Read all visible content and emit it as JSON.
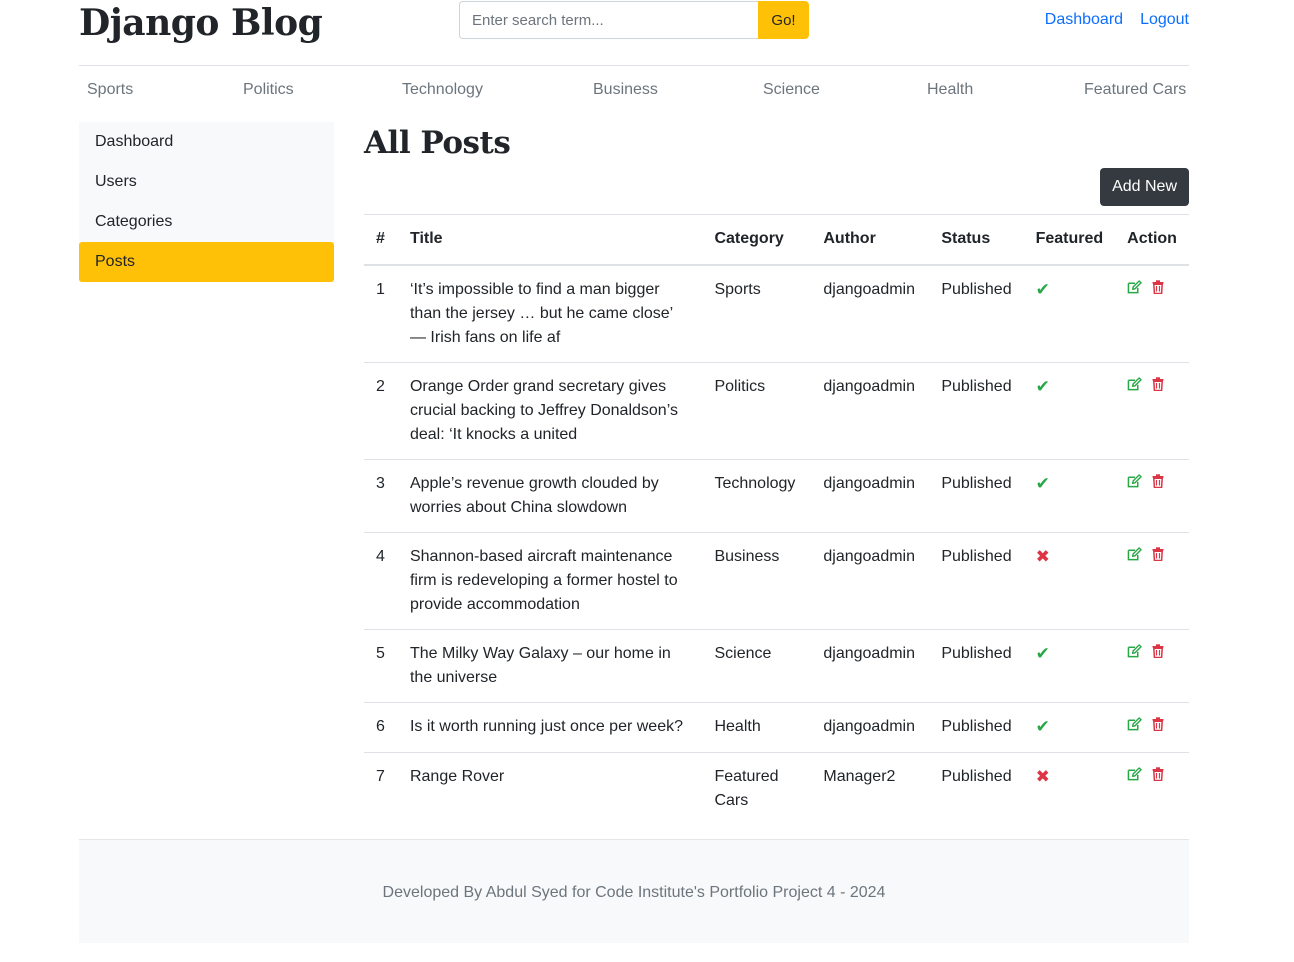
{
  "header": {
    "brand": "Django Blog",
    "search_placeholder": "Enter search term...",
    "search_button": "Go!",
    "links": [
      "Dashboard",
      "Logout"
    ]
  },
  "categories": [
    "Sports",
    "Politics",
    "Technology",
    "Business",
    "Science",
    "Health",
    "Featured Cars"
  ],
  "sidebar": {
    "items": [
      {
        "label": "Dashboard",
        "active": false
      },
      {
        "label": "Users",
        "active": false
      },
      {
        "label": "Categories",
        "active": false
      },
      {
        "label": "Posts",
        "active": true
      }
    ]
  },
  "main": {
    "title": "All Posts",
    "add_button": "Add New",
    "table": {
      "headers": [
        "#",
        "Title",
        "Category",
        "Author",
        "Status",
        "Featured",
        "Action"
      ],
      "rows": [
        {
          "num": "1",
          "title": "‘It’s impossible to find a man bigger than the jersey … but he came close’ — Irish fans on life af",
          "category": "Sports",
          "author": "djangoadmin",
          "status": "Published",
          "featured": true
        },
        {
          "num": "2",
          "title": "Orange Order grand secretary gives crucial backing to Jeffrey Donaldson’s deal: ‘It knocks a united",
          "category": "Politics",
          "author": "djangoadmin",
          "status": "Published",
          "featured": true
        },
        {
          "num": "3",
          "title": "Apple’s revenue growth clouded by worries about China slowdown",
          "category": "Technology",
          "author": "djangoadmin",
          "status": "Published",
          "featured": true
        },
        {
          "num": "4",
          "title": "Shannon-based aircraft maintenance firm is redeveloping a former hostel to provide accommodation",
          "category": "Business",
          "author": "djangoadmin",
          "status": "Published",
          "featured": false
        },
        {
          "num": "5",
          "title": "The Milky Way Galaxy – our home in the universe",
          "category": "Science",
          "author": "djangoadmin",
          "status": "Published",
          "featured": true
        },
        {
          "num": "6",
          "title": "Is it worth running just once per week?",
          "category": "Health",
          "author": "djangoadmin",
          "status": "Published",
          "featured": true
        },
        {
          "num": "7",
          "title": "Range Rover",
          "category": "Featured Cars",
          "author": "Manager2",
          "status": "Published",
          "featured": false
        }
      ]
    }
  },
  "footer": {
    "text": "Developed By Abdul Syed for Code Institute's Portfolio Project 4 - 2024"
  },
  "colors": {
    "accent": "#ffc107",
    "link": "#0d6efd",
    "dark_button": "#343a40",
    "featured_yes": "#28a745",
    "featured_no": "#dc3545",
    "sidebar_bg": "#f8f9fa"
  },
  "icons": {
    "featured_yes": "check-icon",
    "featured_no": "cross-icon",
    "edit": "edit-icon",
    "delete": "trash-icon"
  }
}
